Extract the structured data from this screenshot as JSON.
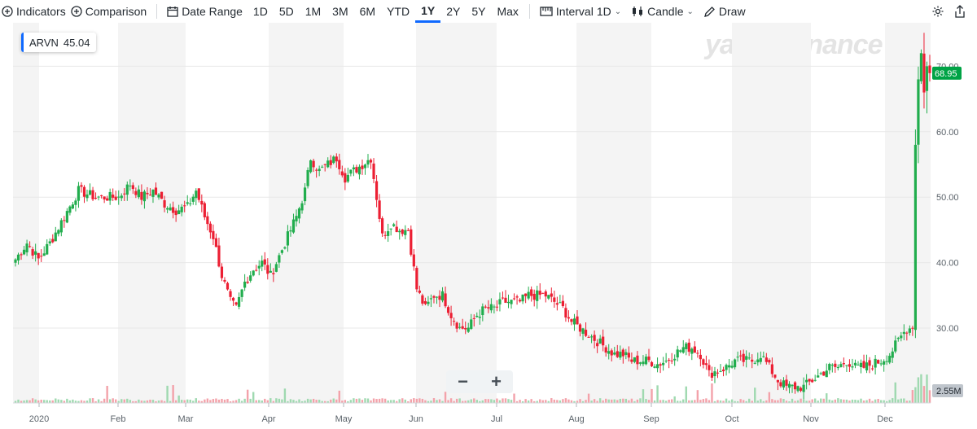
{
  "toolbar": {
    "indicators": "Indicators",
    "comparison": "Comparison",
    "date_range": "Date Range",
    "ranges": [
      "1D",
      "5D",
      "1M",
      "3M",
      "6M",
      "YTD",
      "1Y",
      "2Y",
      "5Y",
      "Max"
    ],
    "active_range": "1Y",
    "interval_label": "Interval",
    "interval_value": "1D",
    "candle": "Candle",
    "draw": "Draw"
  },
  "ticker": {
    "symbol": "ARVN",
    "value": "45.04"
  },
  "watermark": "yahoo!finance",
  "colors": {
    "up": "#21ad4d",
    "down": "#ec1f33",
    "accent": "#0f69ff",
    "price_tag": "#00a345",
    "volume_tag": "#bfc5cc"
  },
  "chart_data": {
    "type": "candlestick",
    "symbol": "ARVN",
    "current_price": "68.95",
    "volume_label": "2.55M",
    "ylim": [
      20,
      80
    ],
    "yticks": [
      30,
      40,
      50,
      60,
      70
    ],
    "ytick_labels": [
      "30.00",
      "40.00",
      "50.00",
      "60.00",
      "70.00"
    ],
    "month_labels": [
      "2020",
      "Feb",
      "Mar",
      "Apr",
      "May",
      "Jun",
      "Jul",
      "Aug",
      "Sep",
      "Oct",
      "Nov",
      "Dec"
    ],
    "grid": "vertical month bands",
    "anchors": [
      [
        0,
        40.5
      ],
      [
        4,
        43
      ],
      [
        8,
        40.5
      ],
      [
        12,
        43
      ],
      [
        17,
        47
      ],
      [
        22,
        51
      ],
      [
        28,
        50
      ],
      [
        32,
        50
      ],
      [
        36,
        50
      ],
      [
        40,
        52
      ],
      [
        44,
        50
      ],
      [
        48,
        51
      ],
      [
        52,
        49
      ],
      [
        56,
        48
      ],
      [
        60,
        48.5
      ],
      [
        63,
        51
      ],
      [
        66,
        47
      ],
      [
        69,
        44
      ],
      [
        72,
        38
      ],
      [
        75,
        34
      ],
      [
        77,
        33
      ],
      [
        80,
        37
      ],
      [
        83,
        39
      ],
      [
        86,
        40
      ],
      [
        89,
        38
      ],
      [
        92,
        41
      ],
      [
        95,
        44
      ],
      [
        98,
        47
      ],
      [
        101,
        51
      ],
      [
        103,
        56
      ],
      [
        106,
        54
      ],
      [
        109,
        55
      ],
      [
        112,
        56
      ],
      [
        115,
        53
      ],
      [
        118,
        54
      ],
      [
        121,
        55
      ],
      [
        124,
        56
      ],
      [
        126,
        50
      ],
      [
        128,
        44
      ],
      [
        131,
        46
      ],
      [
        134,
        45
      ],
      [
        137,
        45
      ],
      [
        140,
        36
      ],
      [
        143,
        33
      ],
      [
        146,
        35
      ],
      [
        149,
        35
      ],
      [
        152,
        32
      ],
      [
        155,
        30
      ],
      [
        158,
        30
      ],
      [
        161,
        32
      ],
      [
        164,
        33
      ],
      [
        167,
        33
      ],
      [
        170,
        34
      ],
      [
        173,
        34
      ],
      [
        176,
        34
      ],
      [
        179,
        35
      ],
      [
        182,
        35
      ],
      [
        185,
        35
      ],
      [
        188,
        34
      ],
      [
        191,
        33
      ],
      [
        194,
        31
      ],
      [
        197,
        30
      ],
      [
        200,
        29
      ],
      [
        203,
        28
      ],
      [
        206,
        27
      ],
      [
        209,
        26
      ],
      [
        212,
        26
      ],
      [
        215,
        25
      ],
      [
        218,
        25
      ],
      [
        221,
        25
      ],
      [
        224,
        24.5
      ],
      [
        227,
        25
      ],
      [
        230,
        26
      ],
      [
        233,
        27
      ],
      [
        236,
        27
      ],
      [
        239,
        26
      ],
      [
        242,
        23
      ],
      [
        245,
        23.5
      ],
      [
        248,
        24
      ],
      [
        251,
        25
      ],
      [
        254,
        25
      ],
      [
        257,
        25
      ],
      [
        260,
        26
      ],
      [
        263,
        24
      ],
      [
        266,
        22
      ],
      [
        269,
        21
      ],
      [
        272,
        21
      ],
      [
        275,
        21
      ],
      [
        278,
        22
      ],
      [
        281,
        23
      ],
      [
        284,
        24
      ],
      [
        287,
        24
      ],
      [
        290,
        25
      ],
      [
        293,
        24
      ],
      [
        296,
        24
      ],
      [
        299,
        24.5
      ],
      [
        302,
        25
      ],
      [
        305,
        26
      ],
      [
        308,
        28
      ],
      [
        311,
        30
      ],
      [
        313,
        30
      ],
      [
        314,
        58
      ],
      [
        315,
        68
      ],
      [
        316,
        72
      ],
      [
        317,
        66
      ],
      [
        318,
        70
      ],
      [
        319,
        68.95
      ]
    ]
  }
}
